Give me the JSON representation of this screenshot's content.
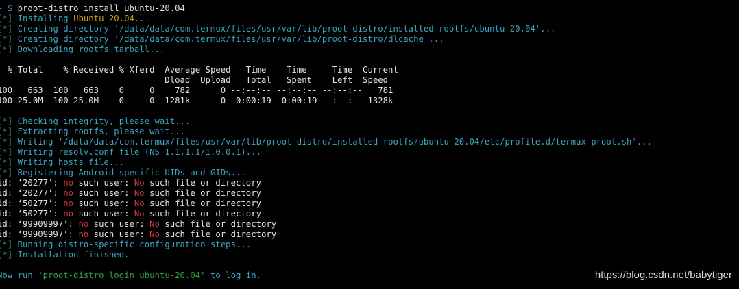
{
  "colors": {
    "background": "#000000",
    "text": "#e2e2e2",
    "bracket": "#3aa3c2",
    "status": "#3aa3c2",
    "accent_yellow": "#c1a11a",
    "error_red": "#d23a3a",
    "link_green": "#2fa044"
  },
  "terminal": {
    "lines": [
      [
        {
          "t": "~ $ ",
          "c": "prompt"
        },
        {
          "t": "proot-distro install ubuntu-20.04",
          "c": "white"
        }
      ],
      [
        {
          "t": "[",
          "c": "cyan"
        },
        {
          "t": "*",
          "c": "green"
        },
        {
          "t": "] ",
          "c": "cyan"
        },
        {
          "t": "Installing ",
          "c": "cyan"
        },
        {
          "t": "Ubuntu 20.04",
          "c": "yellow"
        },
        {
          "t": "...",
          "c": "cyan"
        }
      ],
      [
        {
          "t": "[",
          "c": "cyan"
        },
        {
          "t": "*",
          "c": "green"
        },
        {
          "t": "] ",
          "c": "cyan"
        },
        {
          "t": "Creating directory '/data/data/com.termux/files/usr/var/lib/proot-distro/installed-rootfs/ubuntu-20.04'...",
          "c": "cyan"
        }
      ],
      [
        {
          "t": "[",
          "c": "cyan"
        },
        {
          "t": "*",
          "c": "green"
        },
        {
          "t": "] ",
          "c": "cyan"
        },
        {
          "t": "Creating directory '/data/data/com.termux/files/usr/var/lib/proot-distro/dlcache'...",
          "c": "cyan"
        }
      ],
      [
        {
          "t": "[",
          "c": "cyan"
        },
        {
          "t": "*",
          "c": "green"
        },
        {
          "t": "] ",
          "c": "cyan"
        },
        {
          "t": "Downloading rootfs tarball...",
          "c": "cyan"
        }
      ],
      [],
      [
        {
          "t": "  % Total    % Received % Xferd  Average Speed   Time    Time     Time  Current",
          "c": "white"
        }
      ],
      [
        {
          "t": "                                 Dload  Upload   Total   Spent    Left  Speed",
          "c": "white"
        }
      ],
      [
        {
          "t": "100   663  100   663    0     0    782      0 --:--:-- --:--:-- --:--:--   781",
          "c": "white"
        }
      ],
      [
        {
          "t": "100 25.0M  100 25.0M    0     0  1281k      0  0:00:19  0:00:19 --:--:-- 1328k",
          "c": "white"
        }
      ],
      [],
      [
        {
          "t": "[",
          "c": "cyan"
        },
        {
          "t": "*",
          "c": "green"
        },
        {
          "t": "] ",
          "c": "cyan"
        },
        {
          "t": "Checking integrity, please wait...",
          "c": "cyan"
        }
      ],
      [
        {
          "t": "[",
          "c": "cyan"
        },
        {
          "t": "*",
          "c": "green"
        },
        {
          "t": "] ",
          "c": "cyan"
        },
        {
          "t": "Extracting rootfs, please wait...",
          "c": "cyan"
        }
      ],
      [
        {
          "t": "[",
          "c": "cyan"
        },
        {
          "t": "*",
          "c": "green"
        },
        {
          "t": "] ",
          "c": "cyan"
        },
        {
          "t": "Writing '/data/data/com.termux/files/usr/var/lib/proot-distro/installed-rootfs/ubuntu-20.04/etc/profile.d/termux-proot.sh'...",
          "c": "cyan"
        }
      ],
      [
        {
          "t": "[",
          "c": "cyan"
        },
        {
          "t": "*",
          "c": "green"
        },
        {
          "t": "] ",
          "c": "cyan"
        },
        {
          "t": "Writing resolv.conf file (NS 1.1.1.1/1.0.0.1)...",
          "c": "cyan"
        }
      ],
      [
        {
          "t": "[",
          "c": "cyan"
        },
        {
          "t": "*",
          "c": "green"
        },
        {
          "t": "] ",
          "c": "cyan"
        },
        {
          "t": "Writing hosts file...",
          "c": "cyan"
        }
      ],
      [
        {
          "t": "[",
          "c": "cyan"
        },
        {
          "t": "*",
          "c": "green"
        },
        {
          "t": "] ",
          "c": "cyan"
        },
        {
          "t": "Registering Android-specific UIDs and GIDs...",
          "c": "cyan"
        }
      ],
      [
        {
          "t": "id: ‘20277’: ",
          "c": "white"
        },
        {
          "t": "no",
          "c": "red"
        },
        {
          "t": " such user: ",
          "c": "white"
        },
        {
          "t": "No",
          "c": "red"
        },
        {
          "t": " such file or directory",
          "c": "white"
        }
      ],
      [
        {
          "t": "id: ‘20277’: ",
          "c": "white"
        },
        {
          "t": "no",
          "c": "red"
        },
        {
          "t": " such user: ",
          "c": "white"
        },
        {
          "t": "No",
          "c": "red"
        },
        {
          "t": " such file or directory",
          "c": "white"
        }
      ],
      [
        {
          "t": "id: ‘50277’: ",
          "c": "white"
        },
        {
          "t": "no",
          "c": "red"
        },
        {
          "t": " such user: ",
          "c": "white"
        },
        {
          "t": "No",
          "c": "red"
        },
        {
          "t": " such file or directory",
          "c": "white"
        }
      ],
      [
        {
          "t": "id: ‘50277’: ",
          "c": "white"
        },
        {
          "t": "no",
          "c": "red"
        },
        {
          "t": " such user: ",
          "c": "white"
        },
        {
          "t": "No",
          "c": "red"
        },
        {
          "t": " such file or directory",
          "c": "white"
        }
      ],
      [
        {
          "t": "id: ‘99909997’: ",
          "c": "white"
        },
        {
          "t": "no",
          "c": "red"
        },
        {
          "t": " such user: ",
          "c": "white"
        },
        {
          "t": "No",
          "c": "red"
        },
        {
          "t": " such file or directory",
          "c": "white"
        }
      ],
      [
        {
          "t": "id: ‘99909997’: ",
          "c": "white"
        },
        {
          "t": "no",
          "c": "red"
        },
        {
          "t": " such user: ",
          "c": "white"
        },
        {
          "t": "No",
          "c": "red"
        },
        {
          "t": " such file or directory",
          "c": "white"
        }
      ],
      [
        {
          "t": "[",
          "c": "cyan"
        },
        {
          "t": "*",
          "c": "green"
        },
        {
          "t": "] ",
          "c": "cyan"
        },
        {
          "t": "Running distro-specific configuration steps...",
          "c": "cyan"
        }
      ],
      [
        {
          "t": "[",
          "c": "cyan"
        },
        {
          "t": "*",
          "c": "green"
        },
        {
          "t": "] ",
          "c": "cyan"
        },
        {
          "t": "Installation finished.",
          "c": "cyan"
        }
      ],
      [],
      [
        {
          "t": "Now run '",
          "c": "cyan"
        },
        {
          "t": "proot-distro login ubuntu-20.04",
          "c": "green"
        },
        {
          "t": "' to log in.",
          "c": "cyan"
        }
      ]
    ]
  },
  "watermark": {
    "text": "https://blog.csdn.net/babytiger"
  }
}
